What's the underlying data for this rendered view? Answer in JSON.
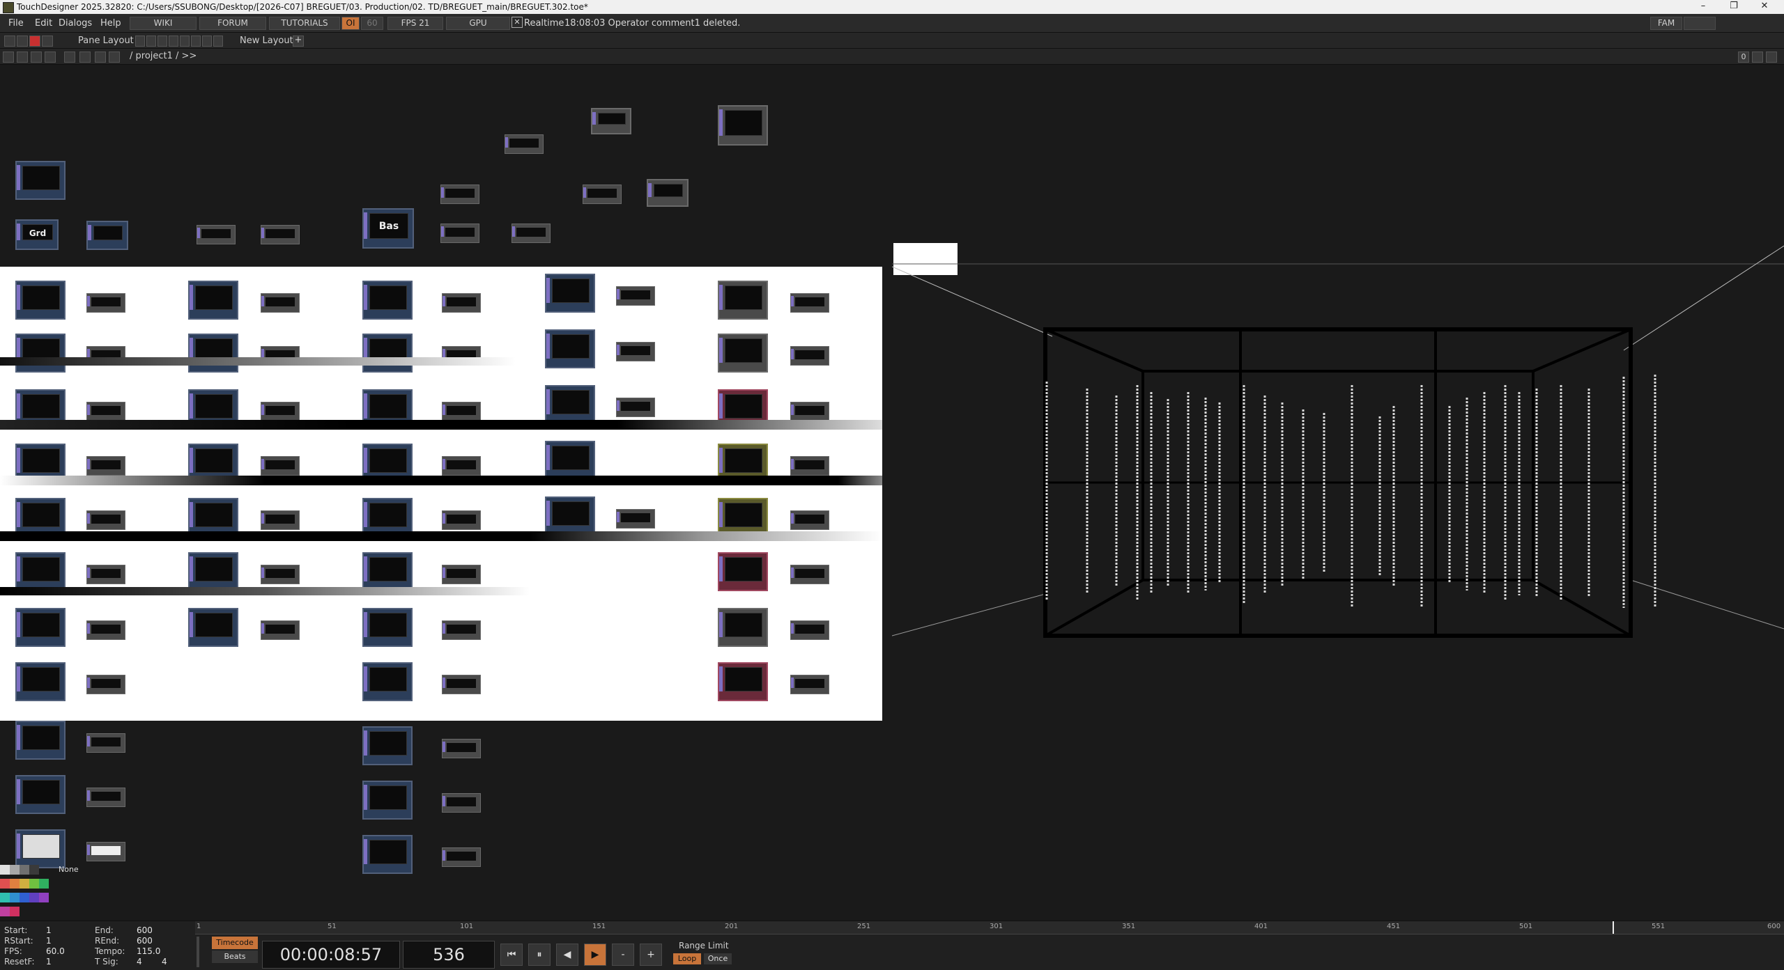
{
  "window": {
    "title": "TouchDesigner 2025.32820: C:/Users/SSUBONG/Desktop/[2026-C07] BREGUET/03. Production/02. TD/BREGUET_main/BREGUET.302.toe*",
    "minimize": "–",
    "maximize": "❐",
    "close": "✕"
  },
  "menubar": {
    "file": "File",
    "edit": "Edit",
    "dialogs": "Dialogs",
    "help": "Help",
    "wiki": "WIKI",
    "forum": "FORUM",
    "tutorials": "TUTORIALS",
    "oi": "OI",
    "fps_cap": "60",
    "fps": "FPS  21",
    "gpu": "GPU",
    "realtime": "Realtime",
    "status_message": "18:08:03 Operator comment1 deleted.",
    "fam": "FAM"
  },
  "toolbar2": {
    "pane_layout": "Pane Layout",
    "new_layout": "New Layout",
    "add": "+"
  },
  "toolbar3": {
    "path": "/ project1 / >>",
    "pane_count": "0"
  },
  "network": {
    "nodes": {
      "grd": "Grd",
      "bas": "Bas"
    }
  },
  "palette": {
    "none": "None",
    "colors": [
      "#e0e0e0",
      "#a8a8a8",
      "#707070",
      "#3a3a3a",
      "#e05050",
      "#e08040",
      "#d0b040",
      "#70c040",
      "#30b060",
      "#30c0b0",
      "#3090d0",
      "#3060d0",
      "#6040c0",
      "#9040c0",
      "#c040a0",
      "#d03060"
    ]
  },
  "timeline": {
    "start_label": "Start:",
    "start": "1",
    "rstart_label": "RStart:",
    "rstart": "1",
    "fps_label": "FPS:",
    "fps": "60.0",
    "resetf_label": "ResetF:",
    "resetf": "1",
    "end_label": "End:",
    "end": "600",
    "rend_label": "REnd:",
    "rend": "600",
    "tempo_label": "Tempo:",
    "tempo": "115.0",
    "tsig_label": "T Sig:",
    "tsig_a": "4",
    "tsig_b": "4",
    "timecode_btn": "Timecode",
    "beats_btn": "Beats",
    "timecode": "00:00:08:57",
    "frame": "536",
    "range_limit": "Range Limit",
    "loop": "Loop",
    "once": "Once",
    "ruler_ticks": [
      "1",
      "51",
      "101",
      "151",
      "201",
      "251",
      "301",
      "351",
      "401",
      "451",
      "501",
      "551",
      "600"
    ]
  }
}
